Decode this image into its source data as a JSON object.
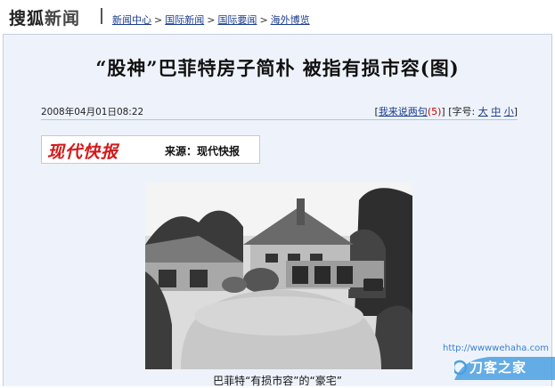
{
  "header": {
    "logo_main": "搜狐",
    "logo_sub": "新闻",
    "breadcrumb": [
      "新闻中心",
      "国际新闻",
      "国际要闻",
      "海外博览"
    ],
    "separator": ">"
  },
  "article": {
    "title": "“股神”巴菲特房子简朴 被指有损市容(图)",
    "datetime": "2008年04月01日08:22",
    "comment_prefix": "[",
    "comment_link": "我来说两句",
    "comment_count": "(5)",
    "comment_suffix": "]",
    "font_size_label": "[字号:",
    "font_sizes": [
      "大",
      "中",
      "小"
    ],
    "font_size_suffix": "]",
    "source_logo": "现代快报",
    "source_text": "来源：现代快报",
    "photo_caption": "巴菲特“有损市容”的“豪宅”"
  },
  "watermark": {
    "url": "http://wwwwehaha.com",
    "name": "刀客之家"
  },
  "colors": {
    "link": "#1a3c8c",
    "panel_bg": "#eef3fb",
    "source_logo": "#d21a1a",
    "count": "#cc0000"
  }
}
